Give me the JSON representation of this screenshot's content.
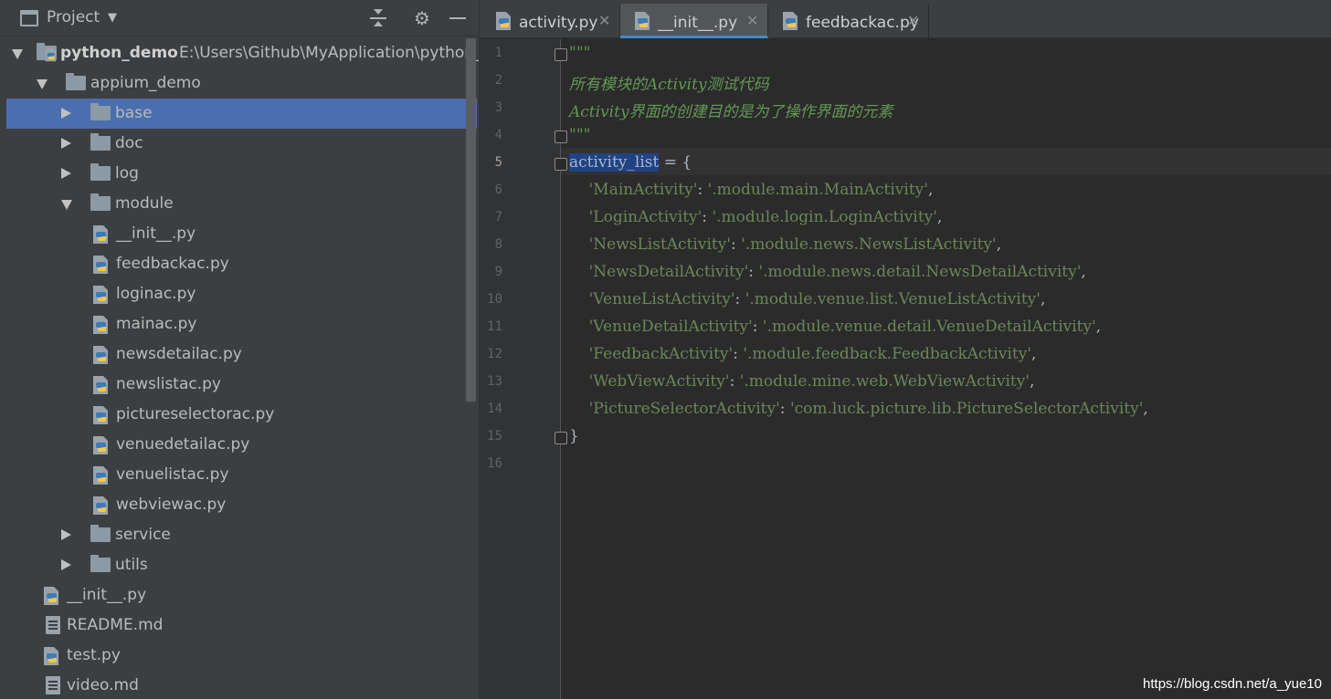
{
  "panel": {
    "title": "Project",
    "tree": [
      {
        "label": "python_demo",
        "path": "E:\\Users\\Github\\MyApplication\\python_pr",
        "type": "project",
        "expanded": true
      },
      {
        "label": "appium_demo",
        "type": "folder",
        "expanded": true
      },
      {
        "label": "base",
        "type": "folder",
        "expanded": false,
        "selected": true
      },
      {
        "label": "doc",
        "type": "folder",
        "expanded": false
      },
      {
        "label": "log",
        "type": "folder",
        "expanded": false
      },
      {
        "label": "module",
        "type": "folder",
        "expanded": true
      },
      {
        "label": "__init__.py",
        "type": "python-file"
      },
      {
        "label": "feedbackac.py",
        "type": "python-file"
      },
      {
        "label": "loginac.py",
        "type": "python-file"
      },
      {
        "label": "mainac.py",
        "type": "python-file"
      },
      {
        "label": "newsdetailac.py",
        "type": "python-file"
      },
      {
        "label": "newslistac.py",
        "type": "python-file"
      },
      {
        "label": "pictureselectorac.py",
        "type": "python-file"
      },
      {
        "label": "venuedetailac.py",
        "type": "python-file"
      },
      {
        "label": "venuelistac.py",
        "type": "python-file"
      },
      {
        "label": "webviewac.py",
        "type": "python-file"
      },
      {
        "label": "service",
        "type": "folder",
        "expanded": false
      },
      {
        "label": "utils",
        "type": "folder",
        "expanded": false
      },
      {
        "label": "__init__.py",
        "type": "python-file"
      },
      {
        "label": "README.md",
        "type": "markdown-file"
      },
      {
        "label": "test.py",
        "type": "python-file"
      },
      {
        "label": "video.md",
        "type": "markdown-file"
      }
    ]
  },
  "tabs": [
    {
      "label": "activity.py",
      "active": false
    },
    {
      "label": "__init__.py",
      "active": true
    },
    {
      "label": "feedbackac.py",
      "active": false
    }
  ],
  "editor": {
    "current_line": 5,
    "lines": [
      {
        "n": "1",
        "segments": [
          {
            "t": "\"\"\"",
            "c": "doc"
          }
        ]
      },
      {
        "n": "2",
        "segments": [
          {
            "t": "所有模块的Activity测试代码",
            "c": "doc"
          }
        ]
      },
      {
        "n": "3",
        "segments": [
          {
            "t": "Activity界面的创建目的是为了操作界面的元素",
            "c": "doc"
          }
        ]
      },
      {
        "n": "4",
        "segments": [
          {
            "t": "\"\"\"",
            "c": "doc"
          }
        ]
      },
      {
        "n": "5",
        "segments": [
          {
            "t": "activity_list",
            "c": "sel"
          },
          {
            "t": " = {",
            "c": "op"
          }
        ]
      },
      {
        "n": "6",
        "segments": [
          {
            "t": "    'MainActivity'",
            "c": "str"
          },
          {
            "t": ": ",
            "c": "op"
          },
          {
            "t": "'.module.main.MainActivity'",
            "c": "str"
          },
          {
            "t": ",",
            "c": "op"
          }
        ]
      },
      {
        "n": "7",
        "segments": [
          {
            "t": "    'LoginActivity'",
            "c": "str"
          },
          {
            "t": ": ",
            "c": "op"
          },
          {
            "t": "'.module.login.LoginActivity'",
            "c": "str"
          },
          {
            "t": ",",
            "c": "op"
          }
        ]
      },
      {
        "n": "8",
        "segments": [
          {
            "t": "    'NewsListActivity'",
            "c": "str"
          },
          {
            "t": ": ",
            "c": "op"
          },
          {
            "t": "'.module.news.NewsListActivity'",
            "c": "str"
          },
          {
            "t": ",",
            "c": "op"
          }
        ]
      },
      {
        "n": "9",
        "segments": [
          {
            "t": "    'NewsDetailActivity'",
            "c": "str"
          },
          {
            "t": ": ",
            "c": "op"
          },
          {
            "t": "'.module.news.detail.NewsDetailActivity'",
            "c": "str"
          },
          {
            "t": ",",
            "c": "op"
          }
        ]
      },
      {
        "n": "10",
        "segments": [
          {
            "t": "    'VenueListActivity'",
            "c": "str"
          },
          {
            "t": ": ",
            "c": "op"
          },
          {
            "t": "'.module.venue.list.VenueListActivity'",
            "c": "str"
          },
          {
            "t": ",",
            "c": "op"
          }
        ]
      },
      {
        "n": "11",
        "segments": [
          {
            "t": "    'VenueDetailActivity'",
            "c": "str"
          },
          {
            "t": ": ",
            "c": "op"
          },
          {
            "t": "'.module.venue.detail.VenueDetailActivity'",
            "c": "str"
          },
          {
            "t": ",",
            "c": "op"
          }
        ]
      },
      {
        "n": "12",
        "segments": [
          {
            "t": "    'FeedbackActivity'",
            "c": "str"
          },
          {
            "t": ": ",
            "c": "op"
          },
          {
            "t": "'.module.feedback.FeedbackActivity'",
            "c": "str"
          },
          {
            "t": ",",
            "c": "op"
          }
        ]
      },
      {
        "n": "13",
        "segments": [
          {
            "t": "    'WebViewActivity'",
            "c": "str"
          },
          {
            "t": ": ",
            "c": "op"
          },
          {
            "t": "'.module.mine.web.WebViewActivity'",
            "c": "str"
          },
          {
            "t": ",",
            "c": "op"
          }
        ]
      },
      {
        "n": "14",
        "segments": [
          {
            "t": "    'PictureSelectorActivity'",
            "c": "str"
          },
          {
            "t": ": ",
            "c": "op"
          },
          {
            "t": "'com.luck.picture.lib.PictureSelectorActivity'",
            "c": "str"
          },
          {
            "t": ",",
            "c": "op"
          }
        ]
      },
      {
        "n": "15",
        "segments": [
          {
            "t": "}",
            "c": "op"
          }
        ]
      },
      {
        "n": "16",
        "segments": []
      }
    ]
  },
  "watermark": "https://blog.csdn.net/a_yue10",
  "colors": {
    "selection": "#4b6eaf",
    "string": "#6a8759",
    "docstring": "#629755",
    "tab_underline": "#4a88c7"
  }
}
